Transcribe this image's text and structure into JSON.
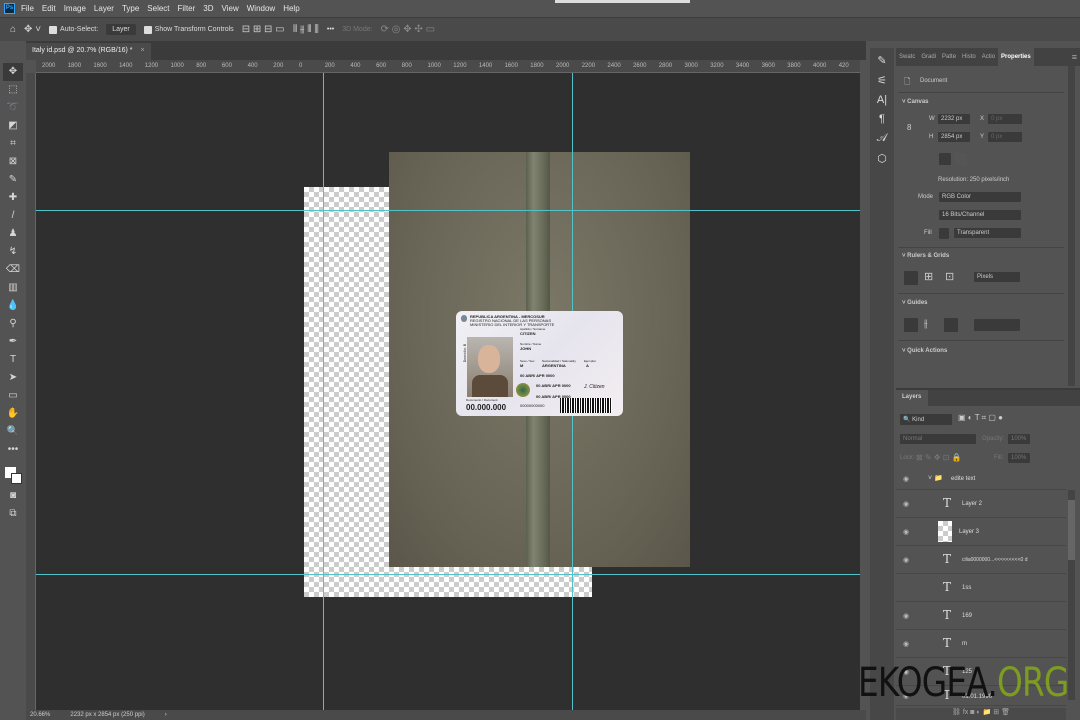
{
  "menu": [
    "File",
    "Edit",
    "Image",
    "Layer",
    "Type",
    "Select",
    "Filter",
    "3D",
    "View",
    "Window",
    "Help"
  ],
  "app_logo": "Ps",
  "options": {
    "auto_select": "Auto-Select:",
    "layer_select": "Layer",
    "show_transform": "Show Transform Controls",
    "more": "•••",
    "mode_3d": "3D Mode:"
  },
  "doc_tab": {
    "title": "Italy id.psd @ 20.7% (RGB/16) *",
    "close": "×"
  },
  "ruler_labels": [
    "2000",
    "1800",
    "1600",
    "1400",
    "1200",
    "1000",
    "800",
    "600",
    "400",
    "200",
    "0",
    "200",
    "400",
    "600",
    "800",
    "1000",
    "1200",
    "1400",
    "1600",
    "1800",
    "2000",
    "2200",
    "2400",
    "2600",
    "2800",
    "3000",
    "3200",
    "3400",
    "3600",
    "3800",
    "4000",
    "420"
  ],
  "status": {
    "zoom": "20.66%",
    "size": "2232 px x 2854 px (250 ppi)",
    "arrow": "›"
  },
  "card": {
    "header": "REPUBLICA ARGENTINA - MERCOSUR",
    "sub1": "REGISTRO NACIONAL DE LAS PERSONAS",
    "sub2": "MINISTERIO DEL INTERIOR Y TRANSPORTE",
    "surname_label": "Apellido / Surname",
    "surname": "CITIZEN",
    "name_label": "Nombre / Name",
    "name": "JOHN",
    "sex_label": "Sexo / Sex",
    "sex": "M",
    "nat_label": "Nacionalidad / Nationality",
    "nat": "ARGENTINA",
    "ex_label": "Ejemplar",
    "ex": "A",
    "dob": "00 ABR/ APR 0000",
    "doi": "00 ABR/ APR 0000",
    "doe": "00 ABR/ APR 0000",
    "doc_label": "Documento / Document",
    "doc": "00.000.000",
    "tramite": "00000000000",
    "side": "Domicilio: B",
    "sig": "J. Citizen"
  },
  "panel": {
    "tabs": [
      "Swatc",
      "Gradi",
      "Patte",
      "Histo",
      "Actio",
      "Properties"
    ],
    "doc_label": "Document",
    "canvas_title": "Canvas",
    "w_label": "W",
    "w": "2232 px",
    "h_label": "H",
    "h": "2854 px",
    "x_label": "X",
    "x": "0 px",
    "y_label": "Y",
    "y": "0 px",
    "resolution": "Resolution: 250 pixels/inch",
    "mode_label": "Mode",
    "mode": "RGB Color",
    "depth": "16 Bits/Channel",
    "fill_label": "Fill",
    "fill": "Transparent",
    "rulers_title": "Rulers & Grids",
    "units": "Pixels",
    "guides_title": "Guides",
    "quick_title": "Quick Actions"
  },
  "layers": {
    "title": "Layers",
    "kind": "Kind",
    "blend": "Normal",
    "opacity_label": "Opacity:",
    "opacity": "100%",
    "lock_label": "Lock:",
    "fill_label": "Fill:",
    "fill": "100%",
    "group": "edite text",
    "items": [
      "Layer 2",
      "Layer 3",
      "cilia0000000...<<<<<<<<<0 d",
      "1ss",
      "169",
      "m",
      "125",
      "01.01.1990"
    ]
  },
  "watermark": {
    "a": "EKOGEA.",
    "b": "ORG"
  },
  "colors": {
    "guide": "#4fc3c8",
    "bg": "#535353",
    "canvas": "#2f2f2f",
    "watermark_green": "#7e9c1f"
  }
}
